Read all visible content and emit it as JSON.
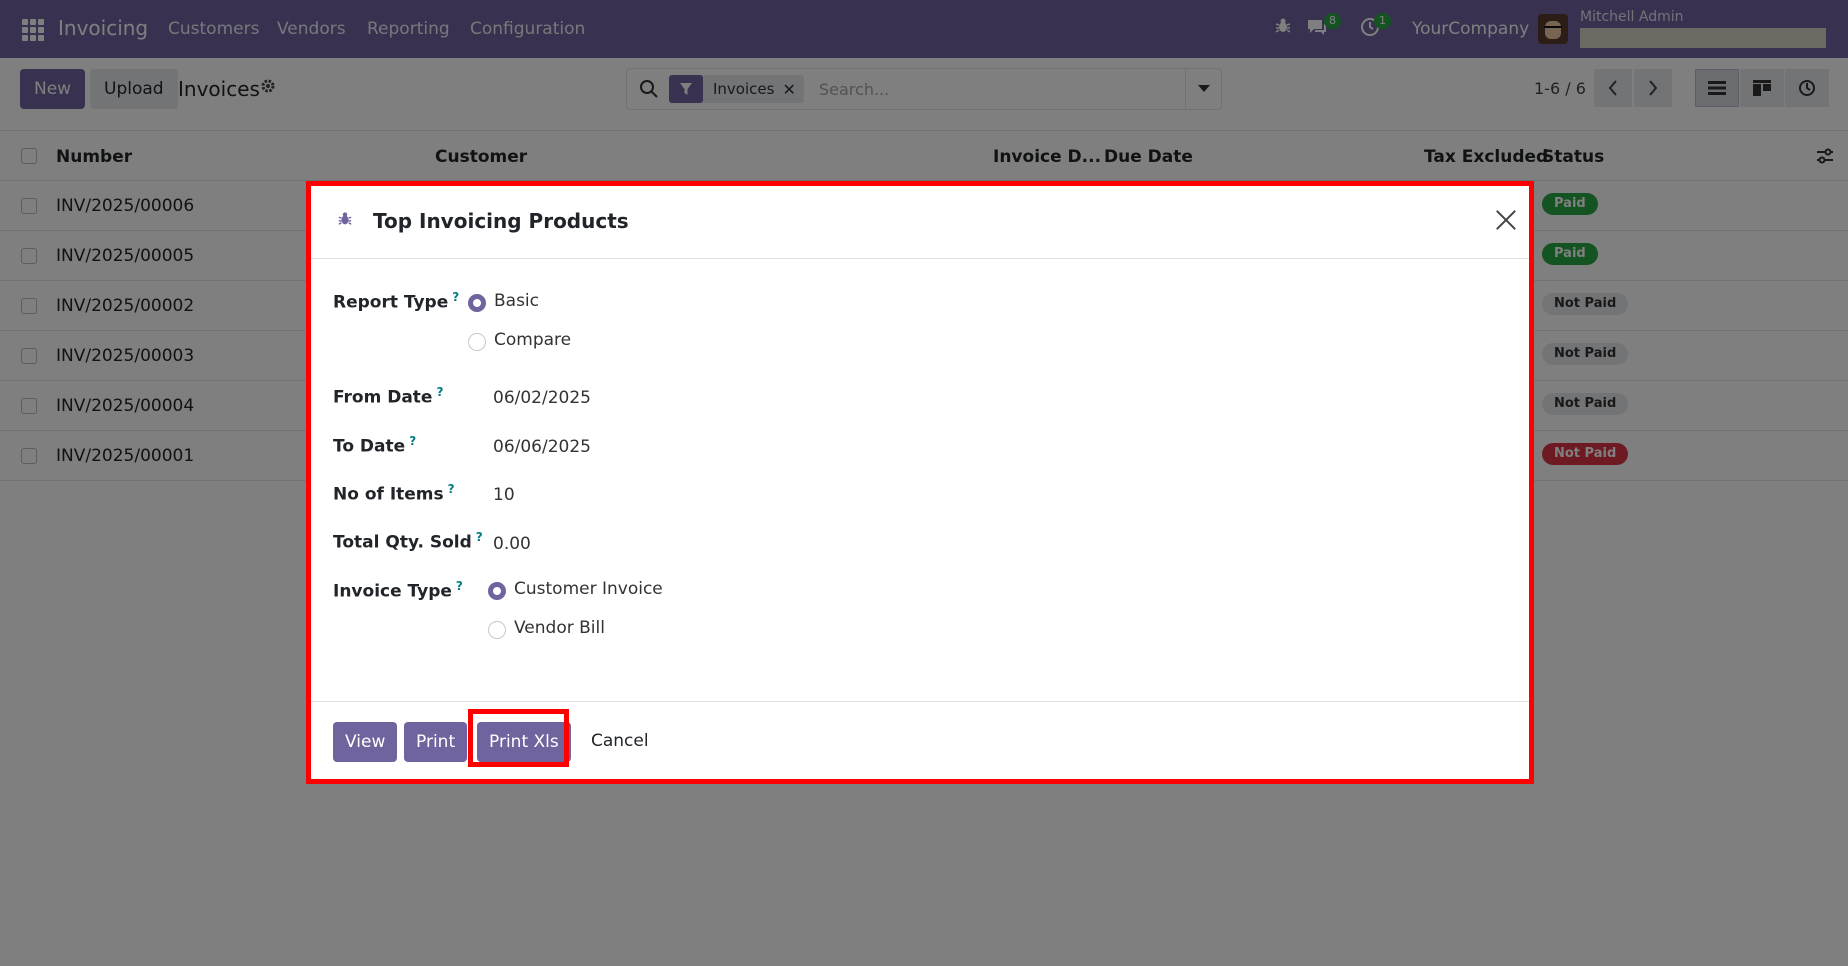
{
  "navbar": {
    "app_name": "Invoicing",
    "menu": [
      "Customers",
      "Vendors",
      "Reporting",
      "Configuration"
    ],
    "messages_count": "8",
    "activities_count": "1",
    "company": "YourCompany",
    "user_name": "Mitchell Admin"
  },
  "control_panel": {
    "new_label": "New",
    "upload_label": "Upload",
    "title": "Invoices",
    "facet_label": "Invoices",
    "search_placeholder": "Search...",
    "pager": "1-6 / 6"
  },
  "list": {
    "columns": [
      "Number",
      "Customer",
      "Invoice D...",
      "Due Date",
      "Tax Excluded",
      "Status"
    ],
    "rows": [
      {
        "number": "INV/2025/00006",
        "status": "Paid",
        "status_color": "#28a745"
      },
      {
        "number": "INV/2025/00005",
        "status": "Paid",
        "status_color": "#28a745"
      },
      {
        "number": "INV/2025/00002",
        "status": "Not Paid",
        "status_color": "#e7e9ed"
      },
      {
        "number": "INV/2025/00003",
        "status": "Not Paid",
        "status_color": "#e7e9ed"
      },
      {
        "number": "INV/2025/00004",
        "status": "Not Paid",
        "status_color": "#e7e9ed"
      },
      {
        "number": "INV/2025/00001",
        "status": "Not Paid",
        "status_color": "#dc3545"
      }
    ]
  },
  "dialog": {
    "title": "Top Invoicing Products",
    "report_type_label": "Report Type",
    "report_type_options": [
      "Basic",
      "Compare"
    ],
    "report_type_selected": "Basic",
    "from_date_label": "From Date",
    "from_date": "06/02/2025",
    "to_date_label": "To Date",
    "to_date": "06/06/2025",
    "no_items_label": "No of Items",
    "no_items": "10",
    "total_qty_label": "Total Qty. Sold",
    "total_qty": "0.00",
    "invoice_type_label": "Invoice Type",
    "invoice_type_options": [
      "Customer Invoice",
      "Vendor Bill"
    ],
    "invoice_type_selected": "Customer Invoice",
    "help_mark": "?",
    "buttons": {
      "view": "View",
      "print": "Print",
      "print_xls": "Print Xls",
      "cancel": "Cancel"
    }
  },
  "colors": {
    "brand": "#71639e",
    "highlight": "#ff0000"
  }
}
